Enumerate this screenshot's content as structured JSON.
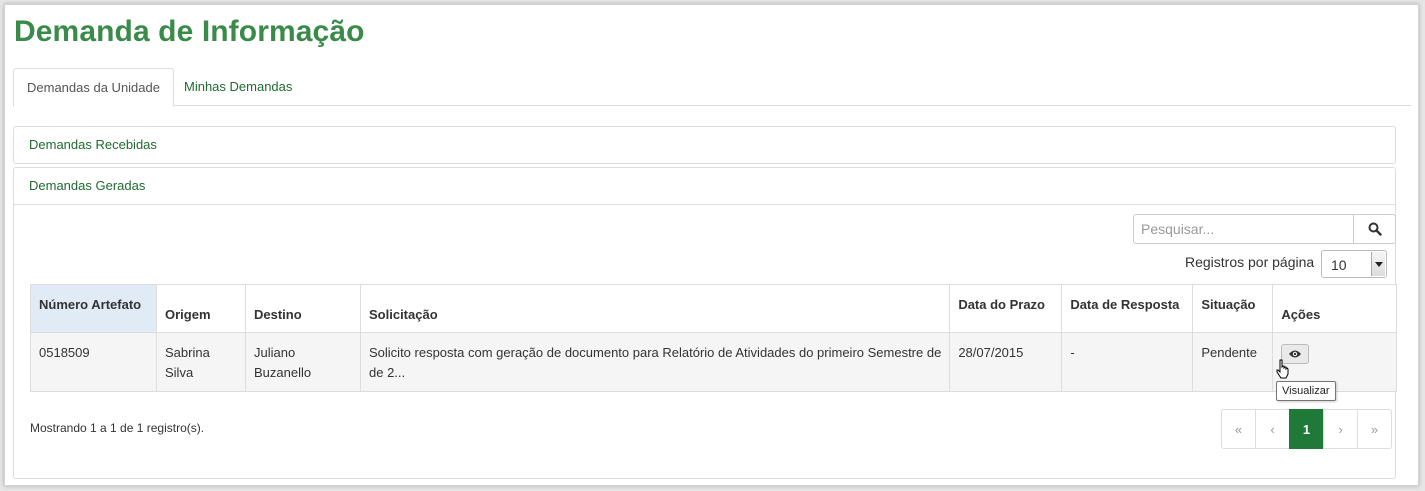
{
  "page": {
    "title": "Demanda de Informação"
  },
  "tabs": [
    {
      "label": "Demandas da Unidade",
      "active": true
    },
    {
      "label": "Minhas Demandas",
      "active": false
    }
  ],
  "panels": {
    "received_label": "Demandas Recebidas",
    "generated_label": "Demandas Geradas"
  },
  "search": {
    "placeholder": "Pesquisar...",
    "value": ""
  },
  "per_page": {
    "label": "Registros por página",
    "value": "10"
  },
  "table": {
    "headers": [
      "Número Artefato",
      "Origem",
      "Destino",
      "Solicitação",
      "Data do Prazo",
      "Data de Resposta",
      "Situação",
      "Ações"
    ],
    "rows": [
      {
        "numero": "0518509",
        "origem_l1": "Sabrina",
        "origem_l2": "Silva",
        "destino_l1": "Juliano",
        "destino_l2": "Buzanello",
        "solicitacao_l1": "Solicito resposta com geração de documento para Relatório de Atividades do primeiro Semestre de",
        "solicitacao_l2": "de 2...",
        "prazo": "28/07/2015",
        "resposta": "-",
        "situacao": "Pendente"
      }
    ]
  },
  "tooltip": "Visualizar",
  "footer": {
    "info": "Mostrando 1 a 1 de 1 registro(s)."
  },
  "pagination": {
    "first": "«",
    "prev": "‹",
    "current": "1",
    "next": "›",
    "last": "»"
  },
  "colors": {
    "brand_green": "#3a8a4a",
    "link_green": "#1f6b2f",
    "active_page": "#1f7a3a",
    "sorted_header": "#e0ebf5"
  },
  "icons": {
    "search": "search-icon",
    "view": "eye-icon",
    "select_arrow": "chevron-down-icon"
  }
}
